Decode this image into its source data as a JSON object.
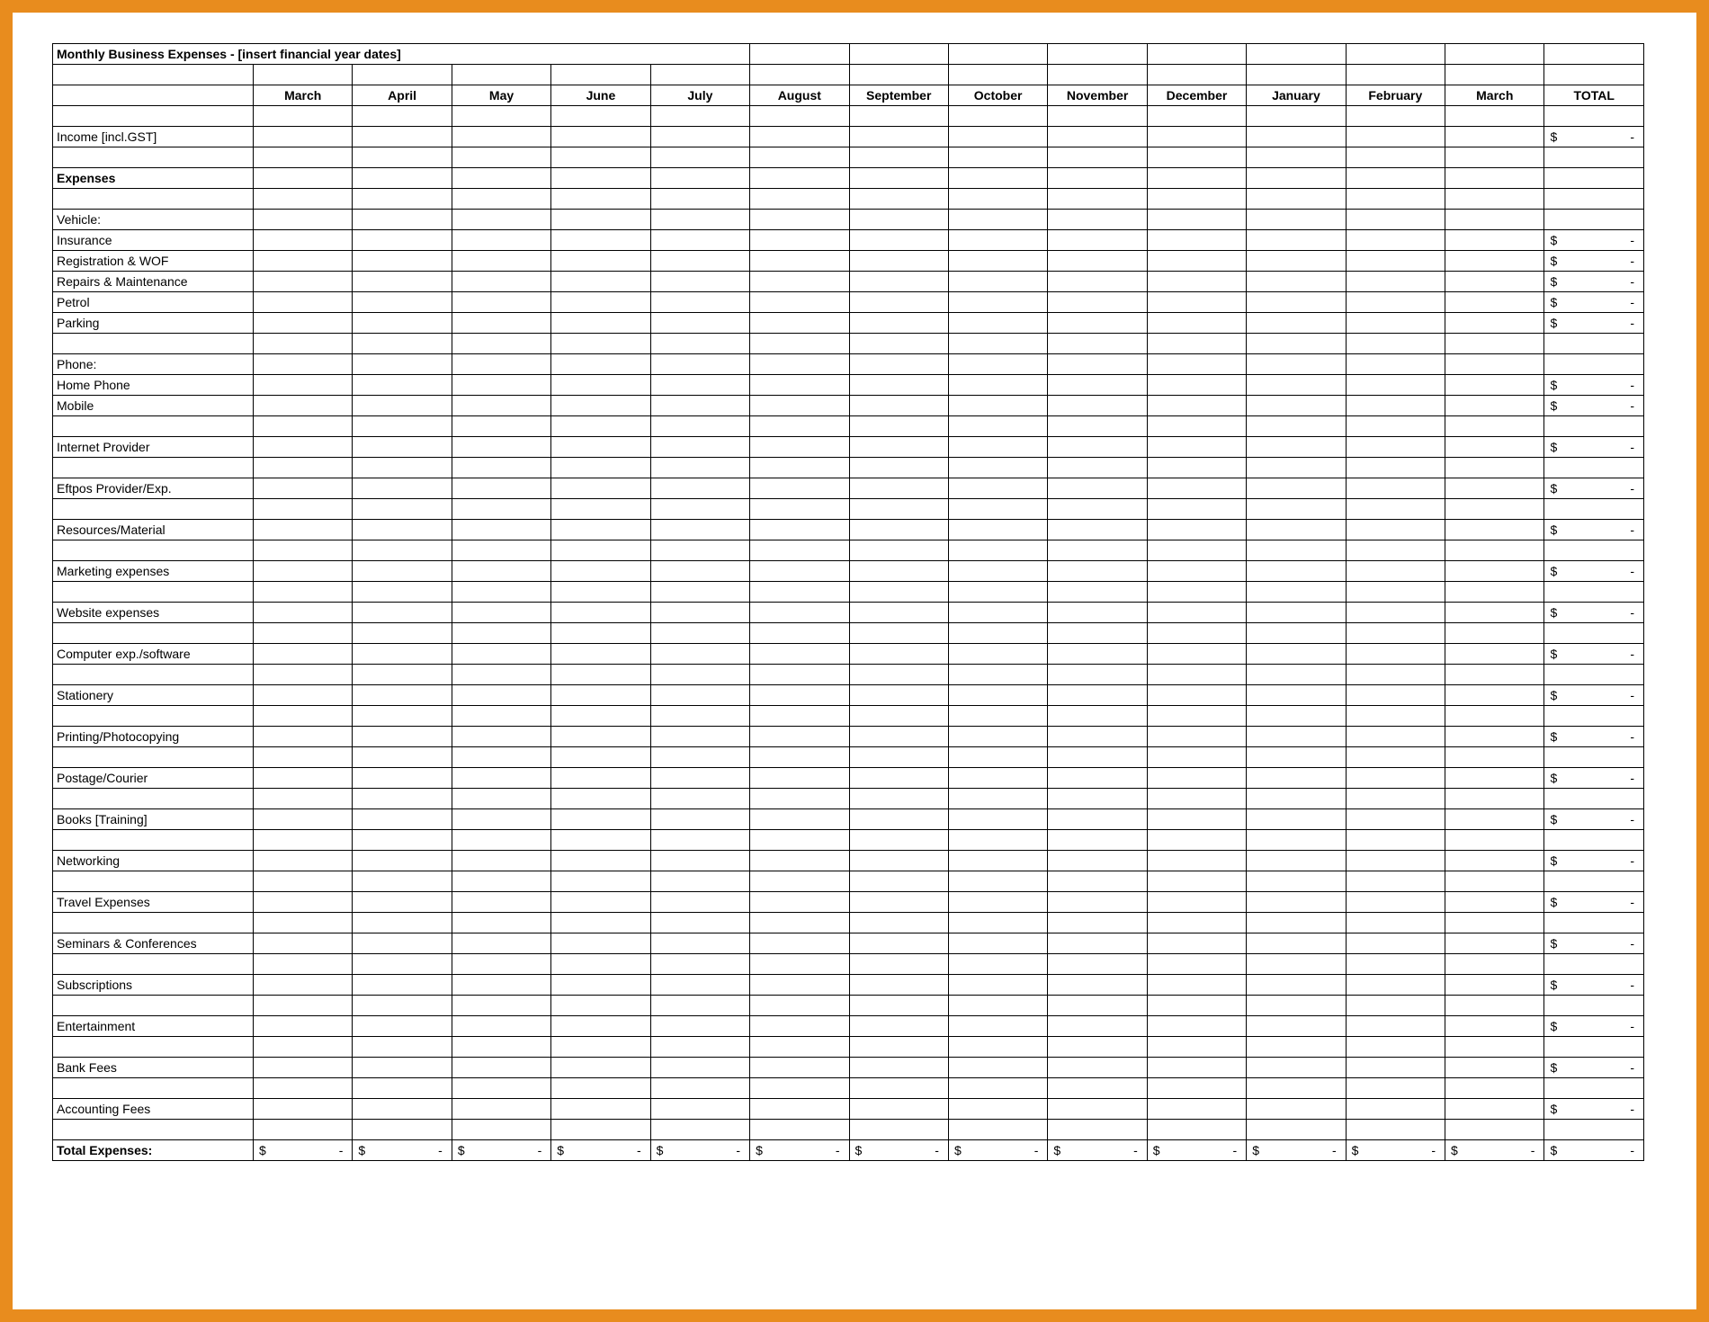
{
  "title": "Monthly Business Expenses - [insert financial year dates]",
  "months": [
    "March",
    "April",
    "May",
    "June",
    "July",
    "August",
    "September",
    "October",
    "November",
    "December",
    "January",
    "February",
    "March"
  ],
  "totalHeader": "TOTAL",
  "incomeLabel": "Income",
  "incomeSuffix": " [incl.GST]",
  "expensesHeader": "Expenses",
  "currencySymbol": "$",
  "dash": "-",
  "groups": [
    {
      "header": "Vehicle:",
      "items": [
        "Insurance",
        "Registration & WOF",
        "Repairs & Maintenance",
        "Petrol",
        "Parking"
      ]
    },
    {
      "header": "Phone:",
      "items": [
        "Home Phone",
        "Mobile"
      ]
    }
  ],
  "singleItems": [
    "Internet Provider",
    "Eftpos Provider/Exp.",
    "Resources/Material",
    "Marketing expenses",
    "Website expenses",
    "Computer exp./software",
    "Stationery",
    "Printing/Photocopying",
    "Postage/Courier",
    "Books [Training]",
    "Networking",
    "Travel Expenses",
    "Seminars & Conferences",
    "Subscriptions",
    "Entertainment",
    "Bank Fees",
    "Accounting Fees"
  ],
  "totalExpensesLabel": "Total Expenses:"
}
